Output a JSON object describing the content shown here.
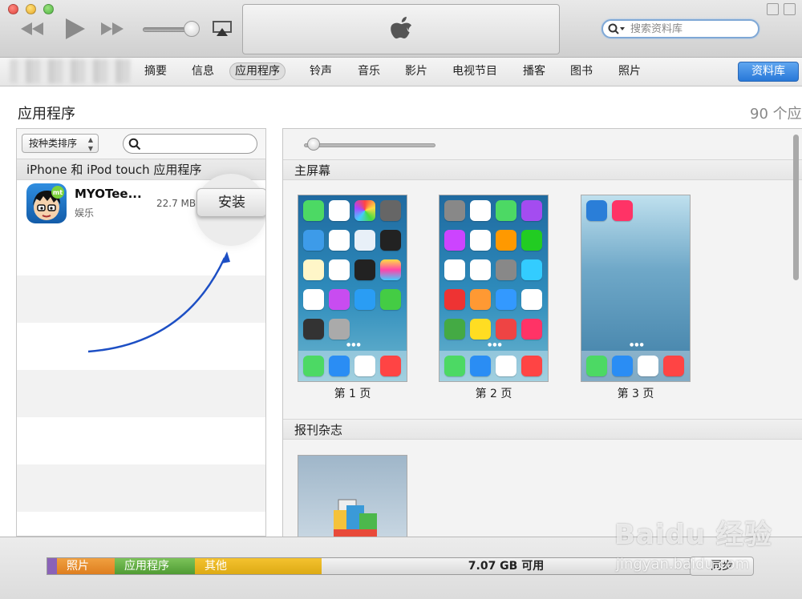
{
  "toolbar": {
    "search_placeholder": "搜索资料库"
  },
  "nav": {
    "tabs": [
      "摘要",
      "信息",
      "应用程序",
      "铃声",
      "音乐",
      "影片",
      "电视节目",
      "播客",
      "图书",
      "照片"
    ],
    "active_tab": "应用程序",
    "library_button": "资料库"
  },
  "page": {
    "title": "应用程序",
    "app_count": "90 个应"
  },
  "left_panel": {
    "sort_label": "按种类排序",
    "heading": "iPhone 和 iPod touch 应用程序",
    "app": {
      "name": "MYOTee...",
      "category": "娱乐",
      "size": "22.7 MB",
      "install_label": "安装"
    }
  },
  "right_panel": {
    "homescreen_label": "主屏幕",
    "pages": [
      "第 1 页",
      "第 2 页",
      "第 3 页"
    ],
    "newsstand_label": "报刊杂志"
  },
  "capacity": {
    "segments": [
      {
        "label": "照片",
        "color": "#e68a2e"
      },
      {
        "label": "应用程序",
        "color": "#62ab44"
      },
      {
        "label": "其他",
        "color": "#e9b722"
      }
    ],
    "free": "7.07 GB 可用",
    "sync_button": "同步"
  },
  "watermark": {
    "logo": "Baidu 经验",
    "url": "jingyan.baidu.com"
  }
}
